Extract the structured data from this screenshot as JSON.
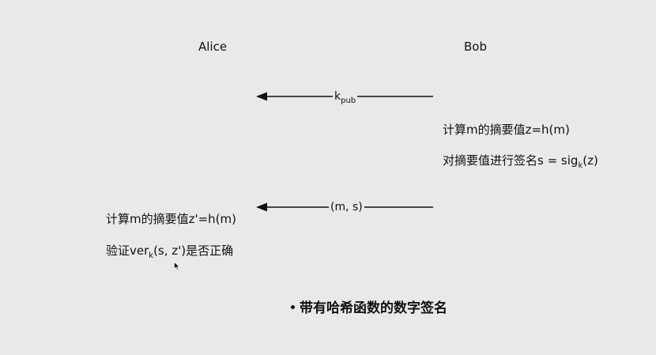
{
  "participants": {
    "alice": "Alice",
    "bob": "Bob"
  },
  "messages": [
    {
      "base": "k",
      "sub": "pub",
      "tail": ""
    },
    {
      "base": "(m, s)",
      "sub": "",
      "tail": ""
    }
  ],
  "bob_steps": [
    {
      "base": "计算m的摘要值z=h(m)",
      "sub": "",
      "tail": ""
    },
    {
      "base": "对摘要值进行签名s = sig",
      "sub": "k",
      "tail": "(z)"
    }
  ],
  "alice_steps": [
    {
      "base": "计算m的摘要值z'=h(m)",
      "sub": "",
      "tail": ""
    },
    {
      "base": "验证ver",
      "sub": "k",
      "tail": "(s, z')是否正确"
    }
  ],
  "caption": "带有哈希函数的数字签名",
  "colors": {
    "background": "#e9e9e9",
    "text": "#111111",
    "arrow": "#111111"
  }
}
